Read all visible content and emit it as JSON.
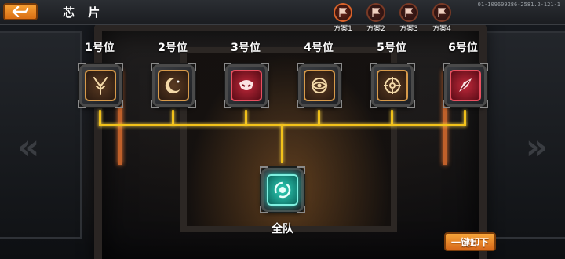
{
  "header": {
    "back_icon": "return-arrow-icon",
    "title": "芯 片",
    "build_id": "01-109609286-2581.2-121-1"
  },
  "presets": [
    {
      "label": "方案1",
      "icon": "flag-icon",
      "active": true
    },
    {
      "label": "方案2",
      "icon": "flag-icon",
      "active": false
    },
    {
      "label": "方案3",
      "icon": "flag-icon",
      "active": false
    },
    {
      "label": "方案4",
      "icon": "flag-icon",
      "active": false
    }
  ],
  "slots": [
    {
      "label": "1号位",
      "chip_icon": "tree-icon",
      "chip_color": "#d79a4a"
    },
    {
      "label": "2号位",
      "chip_icon": "crescent-moon-icon",
      "chip_color": "#d79a4a"
    },
    {
      "label": "3号位",
      "chip_icon": "beast-icon",
      "chip_color": "#c0283a"
    },
    {
      "label": "4号位",
      "chip_icon": "eye-icon",
      "chip_color": "#d79a4a"
    },
    {
      "label": "5号位",
      "chip_icon": "crosshair-icon",
      "chip_color": "#d79a4a"
    },
    {
      "label": "6号位",
      "chip_icon": "shard-icon",
      "chip_color": "#c0283a"
    }
  ],
  "team_slot": {
    "label": "全队",
    "chip_icon": "swirl-icon",
    "chip_color": "#2fd0b8"
  },
  "actions": {
    "unequip_all": "一键卸下"
  },
  "colors": {
    "accent_orange": "#e07a1f",
    "connector_yellow": "#f2c21a"
  }
}
